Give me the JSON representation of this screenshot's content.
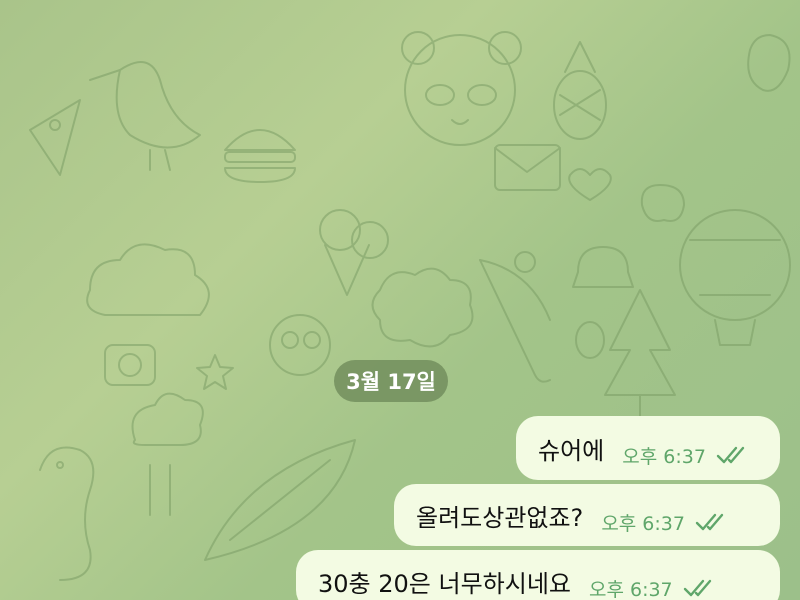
{
  "chat": {
    "date_separator": "3월 17일",
    "messages": [
      {
        "text": "슈어에",
        "time": "오후 6:37",
        "status_icon": "double-check-read-icon"
      },
      {
        "text": "올려도상관없죠?",
        "time": "오후 6:37",
        "status_icon": "double-check-read-icon"
      },
      {
        "text": "30충 20은 너무하시네요",
        "time": "오후 6:37",
        "status_icon": "double-check-read-icon"
      }
    ]
  },
  "colors": {
    "wallpaper": "#a9c48a",
    "outgoing_bubble": "#f3fbe3",
    "time_and_check": "#5fa66a",
    "date_pill": "#708c5c"
  }
}
